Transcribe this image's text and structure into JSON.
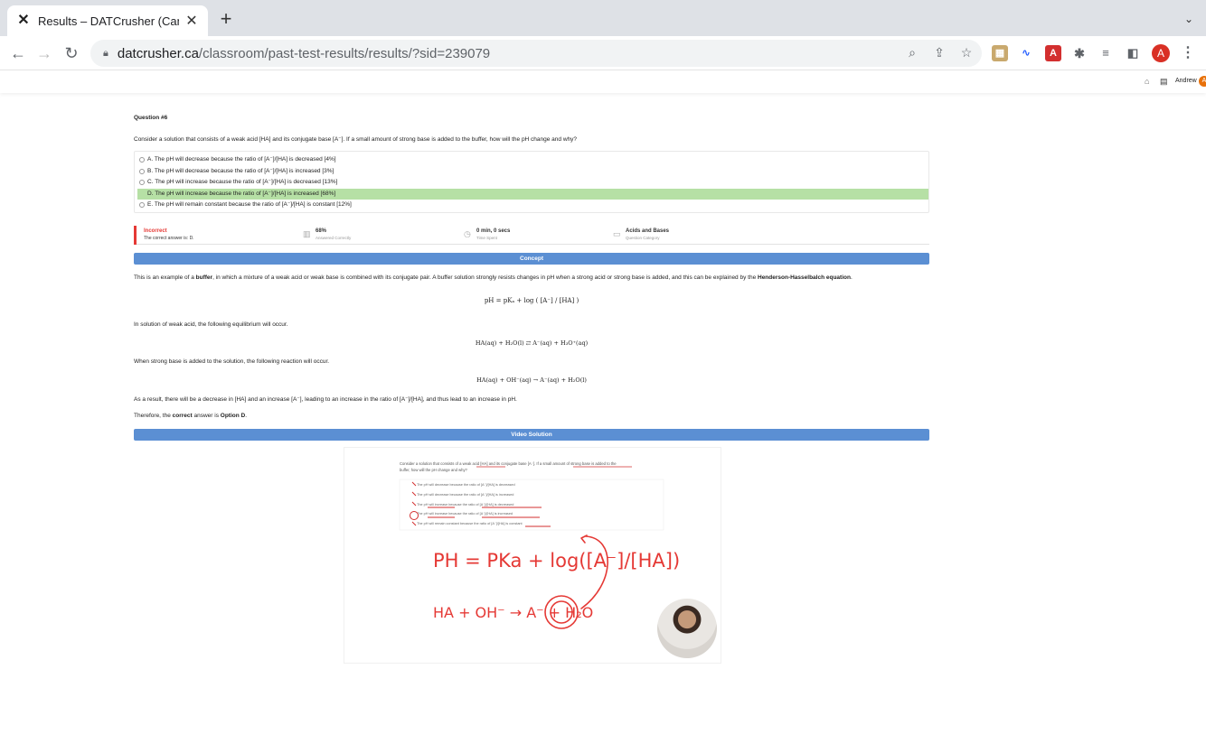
{
  "browser": {
    "tab_title": "Results – DATCrusher (Canadia",
    "url_domain": "datcrusher.ca",
    "url_path": "/classroom/past-test-results/results/?sid=239079",
    "profile_initial": "A"
  },
  "site_header": {
    "user_name": "Andrew",
    "user_initial": "A"
  },
  "question": {
    "number_label": "Question #6",
    "text": "Consider a solution that consists of a weak acid [HA] and its conjugate base [A⁻]. If a small amount of strong base is added to the buffer, how will the pH change and why?",
    "choices": [
      "A. The pH will decrease because the ratio of [A⁻]/[HA] is decreased [4%]",
      "B. The pH will decrease because the ratio of [A⁻]/[HA] is increased [3%]",
      "C. The pH will increase because the ratio of [A⁻]/[HA] is decreased [13%]",
      "D. The pH will increase because the ratio of [A⁻]/[HA] is increased [68%]",
      "E. The pH will remain constant because the ratio of [A⁻]/[HA] is constant [12%]"
    ],
    "correct_index": 3
  },
  "stats": {
    "result": "Incorrect",
    "correct_answer": "The correct answer is: D.",
    "percent": "68%",
    "percent_label": "Answered Correctly",
    "time": "0 min, 0 secs",
    "time_label": "Time Spent",
    "category": "Acids and Bases",
    "category_label": "Question Category"
  },
  "concept": {
    "header": "Concept",
    "intro_1": "This is an example of a ",
    "intro_bold_1": "buffer",
    "intro_2": ", in which a mixture of a weak acid or weak base is combined with its conjugate pair. A buffer solution strongly resists changes in pH when a strong acid or strong base is added, and this can be explained by the ",
    "intro_bold_2": "Henderson-Hasselbalch equation",
    "intro_3": ".",
    "equation_1": "pH = pKₐ + log ( [A⁻] / [HA] )",
    "para_2": "In solution of weak acid, the following equilibrium will occur.",
    "equation_2": "HA(aq) + H₂O(l) ⇄ A⁻(aq) + H₃O⁺(aq)",
    "para_3": "When strong base is added to the solution, the following reaction will occur.",
    "equation_3": "HA(aq) + OH⁻(aq) → A⁻(aq) + H₂O(l)",
    "para_4": "As a result, there will be a decrease in [HA] and an increase [A⁻], leading to an increase in the ratio of [A⁻]/[HA], and thus lead to an increase in pH.",
    "conclusion_1": "Therefore, the ",
    "conclusion_bold_1": "correct",
    "conclusion_2": " answer is ",
    "conclusion_bold_2": "Option D",
    "conclusion_3": "."
  },
  "video": {
    "header": "Video Solution",
    "handwritten_1": "PH = PKa + log([A⁻]/[HA])",
    "handwritten_2": "HA + OH⁻ → A⁻ + H₂O"
  }
}
